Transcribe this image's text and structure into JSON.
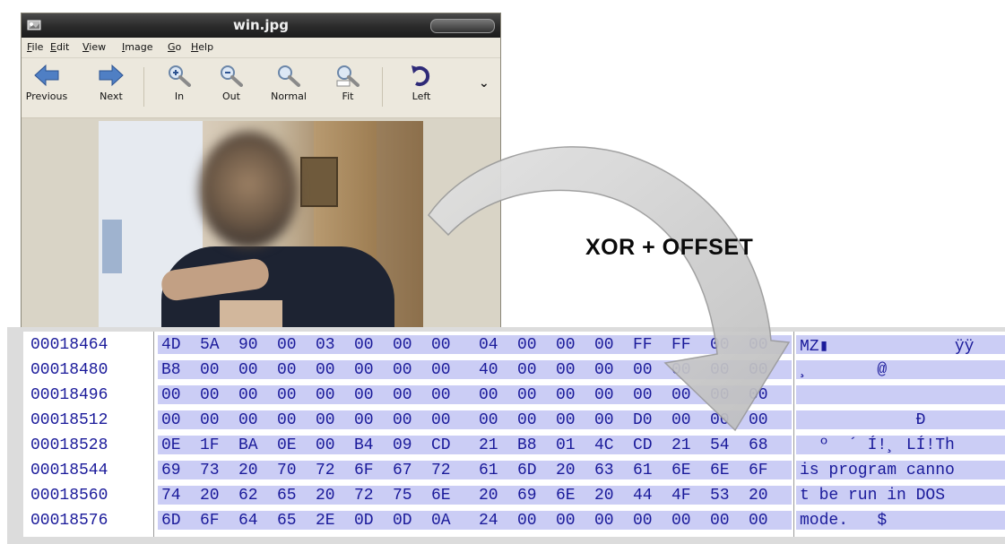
{
  "window": {
    "title": "win.jpg",
    "menu": [
      "File",
      "Edit",
      "View",
      "Image",
      "Go",
      "Help"
    ],
    "toolbar": {
      "previous": "Previous",
      "next": "Next",
      "zoom_in": "In",
      "zoom_out": "Out",
      "normal": "Normal",
      "fit": "Fit",
      "rotate_left": "Left"
    }
  },
  "caption": "XOR + OFFSET",
  "colors": {
    "hex_text": "#1a1a9a",
    "hex_row_bg": "#cbcdf5",
    "arrow": "#c8c8c8"
  },
  "hex_rows": [
    {
      "addr": "00018464",
      "bytes": [
        "4D",
        "5A",
        "90",
        "00",
        "03",
        "00",
        "00",
        "00",
        "04",
        "00",
        "00",
        "00",
        "FF",
        "FF",
        "00",
        "00"
      ],
      "ascii": "MZ▮             ÿÿ"
    },
    {
      "addr": "00018480",
      "bytes": [
        "B8",
        "00",
        "00",
        "00",
        "00",
        "00",
        "00",
        "00",
        "40",
        "00",
        "00",
        "00",
        "00",
        "00",
        "00",
        "00"
      ],
      "ascii": "¸       @"
    },
    {
      "addr": "00018496",
      "bytes": [
        "00",
        "00",
        "00",
        "00",
        "00",
        "00",
        "00",
        "00",
        "00",
        "00",
        "00",
        "00",
        "00",
        "00",
        "00",
        "00"
      ],
      "ascii": ""
    },
    {
      "addr": "00018512",
      "bytes": [
        "00",
        "00",
        "00",
        "00",
        "00",
        "00",
        "00",
        "00",
        "00",
        "00",
        "00",
        "00",
        "D0",
        "00",
        "00",
        "00"
      ],
      "ascii": "            Ð"
    },
    {
      "addr": "00018528",
      "bytes": [
        "0E",
        "1F",
        "BA",
        "0E",
        "00",
        "B4",
        "09",
        "CD",
        "21",
        "B8",
        "01",
        "4C",
        "CD",
        "21",
        "54",
        "68"
      ],
      "ascii": "  º  ´ Í!¸ LÍ!Th"
    },
    {
      "addr": "00018544",
      "bytes": [
        "69",
        "73",
        "20",
        "70",
        "72",
        "6F",
        "67",
        "72",
        "61",
        "6D",
        "20",
        "63",
        "61",
        "6E",
        "6E",
        "6F"
      ],
      "ascii": "is program canno"
    },
    {
      "addr": "00018560",
      "bytes": [
        "74",
        "20",
        "62",
        "65",
        "20",
        "72",
        "75",
        "6E",
        "20",
        "69",
        "6E",
        "20",
        "44",
        "4F",
        "53",
        "20"
      ],
      "ascii": "t be run in DOS "
    },
    {
      "addr": "00018576",
      "bytes": [
        "6D",
        "6F",
        "64",
        "65",
        "2E",
        "0D",
        "0D",
        "0A",
        "24",
        "00",
        "00",
        "00",
        "00",
        "00",
        "00",
        "00"
      ],
      "ascii": "mode.   $"
    }
  ]
}
